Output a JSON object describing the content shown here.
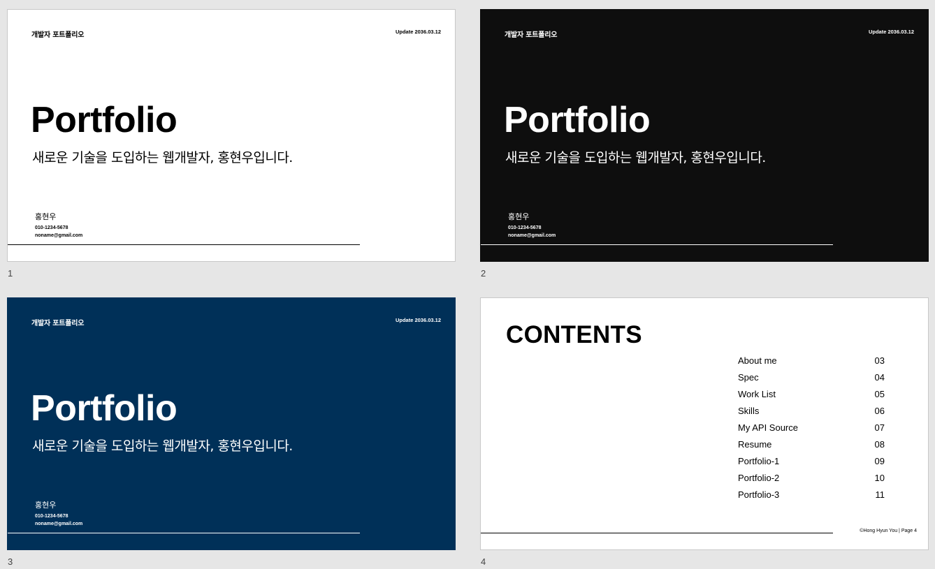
{
  "slides": [
    {
      "number": "1",
      "header_title": "개발자 포트폴리오",
      "update": "Update 2036.03.12",
      "title": "Portfolio",
      "subtitle": "새로운 기술을 도입하는 웹개발자, 홍현우입니다.",
      "name": "홍현우",
      "phone": "010-1234-5678",
      "email": "noname@gmail.com",
      "background": "#ffffff"
    },
    {
      "number": "2",
      "header_title": "개발자 포트폴리오",
      "update": "Update 2036.03.12",
      "title": "Portfolio",
      "subtitle": "새로운 기술을 도입하는 웹개발자, 홍현우입니다.",
      "name": "홍현우",
      "phone": "010-1234-5678",
      "email": "noname@gmail.com",
      "background": "#0e0e0e"
    },
    {
      "number": "3",
      "header_title": "개발자 포트폴리오",
      "update": "Update 2036.03.12",
      "title": "Portfolio",
      "subtitle": "새로운 기술을 도입하는 웹개발자, 홍현우입니다.",
      "name": "홍현우",
      "phone": "010-1234-5678",
      "email": "noname@gmail.com",
      "background": "#003058"
    },
    {
      "number": "4",
      "title": "CONTENTS",
      "toc": [
        {
          "label": "About me",
          "page": "03"
        },
        {
          "label": "Spec",
          "page": "04"
        },
        {
          "label": "Work List",
          "page": "05"
        },
        {
          "label": "Skills",
          "page": "06"
        },
        {
          "label": "My API Source",
          "page": "07"
        },
        {
          "label": "Resume",
          "page": "08"
        },
        {
          "label": "Portfolio-1",
          "page": "09"
        },
        {
          "label": "Portfolio-2",
          "page": "10"
        },
        {
          "label": "Portfolio-3",
          "page": "11"
        }
      ],
      "footer": "©Hong Hyun You | Page 4",
      "background": "#ffffff"
    }
  ]
}
